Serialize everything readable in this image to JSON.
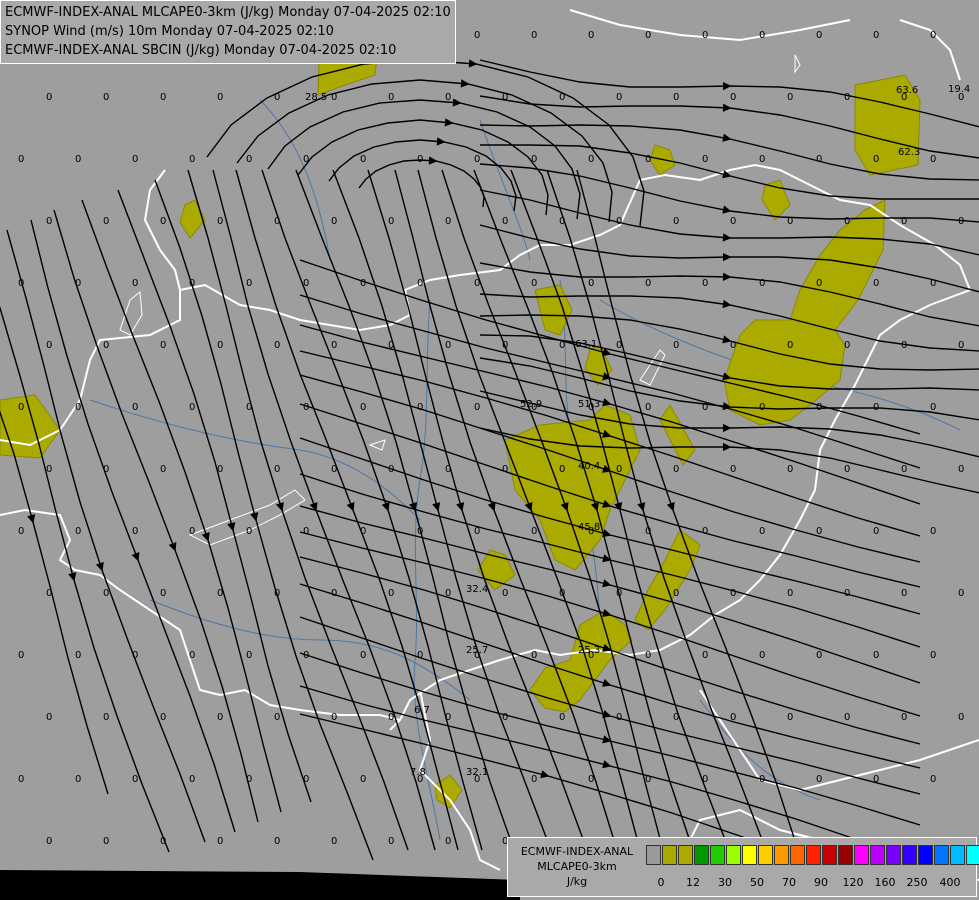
{
  "title": {
    "line1": "ECMWF-INDEX-ANAL MLCAPE0-3km (J/kg) Monday 07-04-2025 02:10",
    "line2": "SYNOP Wind (m/s) 10m Monday 07-04-2025 02:10",
    "line3": "ECMWF-INDEX-ANAL SBCIN (J/kg) Monday 07-04-2025 02:10"
  },
  "legend": {
    "model": "ECMWF-INDEX-ANAL",
    "param": "MLCAPE0-3km",
    "unit": "J/kg",
    "colors": [
      "#999999",
      "#a8a800",
      "#aaaa00",
      "#009900",
      "#22cc00",
      "#99ff00",
      "#ffff00",
      "#ffcc00",
      "#ff9900",
      "#ff6600",
      "#ff2200",
      "#cc0000",
      "#990000",
      "#ff00ff",
      "#bb00ff",
      "#7700ff",
      "#3300ff",
      "#0000ff",
      "#0077ff",
      "#00bbff",
      "#00ffff",
      "#99ffff",
      "#ffffff"
    ],
    "ticks": [
      "0",
      "12",
      "30",
      "50",
      "70",
      "90",
      "120",
      "160",
      "250",
      "400"
    ]
  },
  "cape_labels": [
    "28.5",
    "19.4",
    "63.6",
    "62.3",
    "63.1",
    "52.9",
    "51.3",
    "40.4",
    "45.8",
    "32.4",
    "25.7",
    "25.3",
    "6.7",
    "7.8",
    "32.1"
  ],
  "zero_label": "0"
}
